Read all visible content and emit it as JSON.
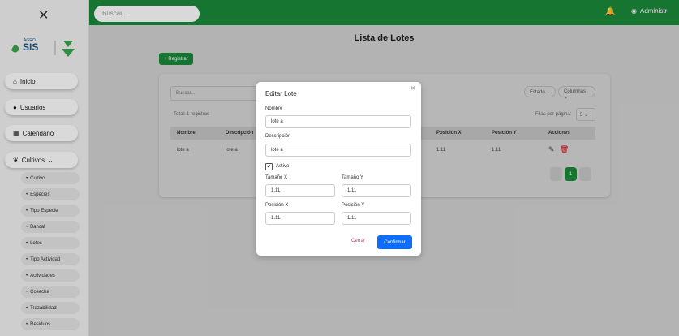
{
  "topbar": {
    "search_placeholder": "Buscar...",
    "user_label": "Administr"
  },
  "sidebar": {
    "close": "✕",
    "logo_text": "AGROSIS",
    "main_items": [
      {
        "label": "Inicio",
        "icon": "home-icon"
      },
      {
        "label": "Usuarios",
        "icon": "user-icon"
      },
      {
        "label": "Calendario",
        "icon": "calendar-icon"
      },
      {
        "label": "Cultivos",
        "icon": "leaf-icon"
      }
    ],
    "sub_items": [
      "Cultivo",
      "Especies",
      "Tipo Especie",
      "Bancal",
      "Lotes",
      "Tipo Actividad",
      "Actividades",
      "Cosecha",
      "Trazabilidad",
      "Residuos"
    ]
  },
  "page": {
    "title": "Lista de Lotes",
    "register_button": "+ Registrar"
  },
  "table": {
    "search_placeholder": "Buscar...",
    "estado": "Estado",
    "columnas": "Columnas",
    "total": "Total: 1 registros",
    "filas_por_pagina": "Filas por página:",
    "filas_value": "5",
    "headers": [
      "Nombre",
      "Descripción",
      "Posición X",
      "Posición Y",
      "Acciones"
    ],
    "row": {
      "nombre": "lote a",
      "descripcion": "lote a",
      "posx": "1.11",
      "posy": "1.11"
    },
    "page_number": "1"
  },
  "modal": {
    "title": "Editar Lote",
    "nombre_label": "Nombre",
    "nombre_value": "lote a",
    "descripcion_label": "Descripción",
    "descripcion_value": "lote a",
    "activo_label": "Activo",
    "tamx_label": "Tamaño X",
    "tamx_value": "1.11",
    "tamy_label": "Tamaño Y",
    "tamy_value": "1.11",
    "posx_label": "Posición X",
    "posx_value": "1.11",
    "posy_label": "Posición Y",
    "posy_value": "1.11",
    "cerrar": "Cerrar",
    "confirmar": "Confirmar"
  },
  "colors": {
    "green": "#1a8a3a",
    "blue": "#0d6efd",
    "pink": "#d63384"
  }
}
